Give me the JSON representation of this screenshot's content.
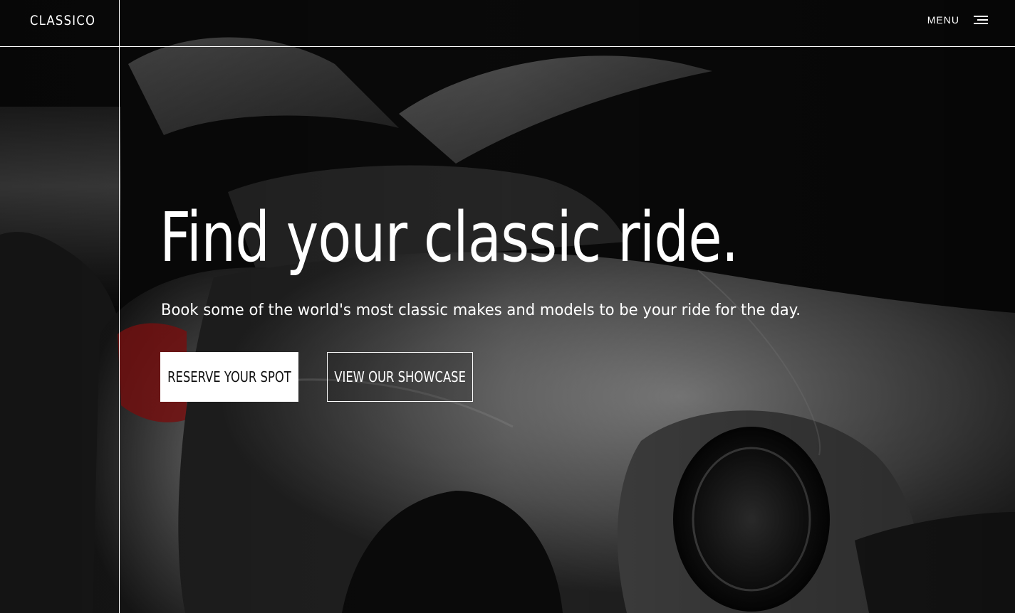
{
  "header": {
    "logo": "CLASSICO",
    "menu_label": "MENU"
  },
  "hero": {
    "headline": "Find your classic ride.",
    "subheadline": "Book some of the world's most classic makes and models to be your ride for the day.",
    "primary_button": "RESERVE YOUR SPOT",
    "secondary_button": "VIEW OUR SHOWCASE",
    "background_image": "classic gullwing car in dark showroom, doors open"
  },
  "colors": {
    "text": "#ffffff",
    "frame_line": "#ffffff",
    "primary_button_bg": "#ffffff",
    "primary_button_text": "#111111",
    "taillight_accent": "#b01818"
  },
  "icons": {
    "menu": "hamburger-menu-icon"
  }
}
